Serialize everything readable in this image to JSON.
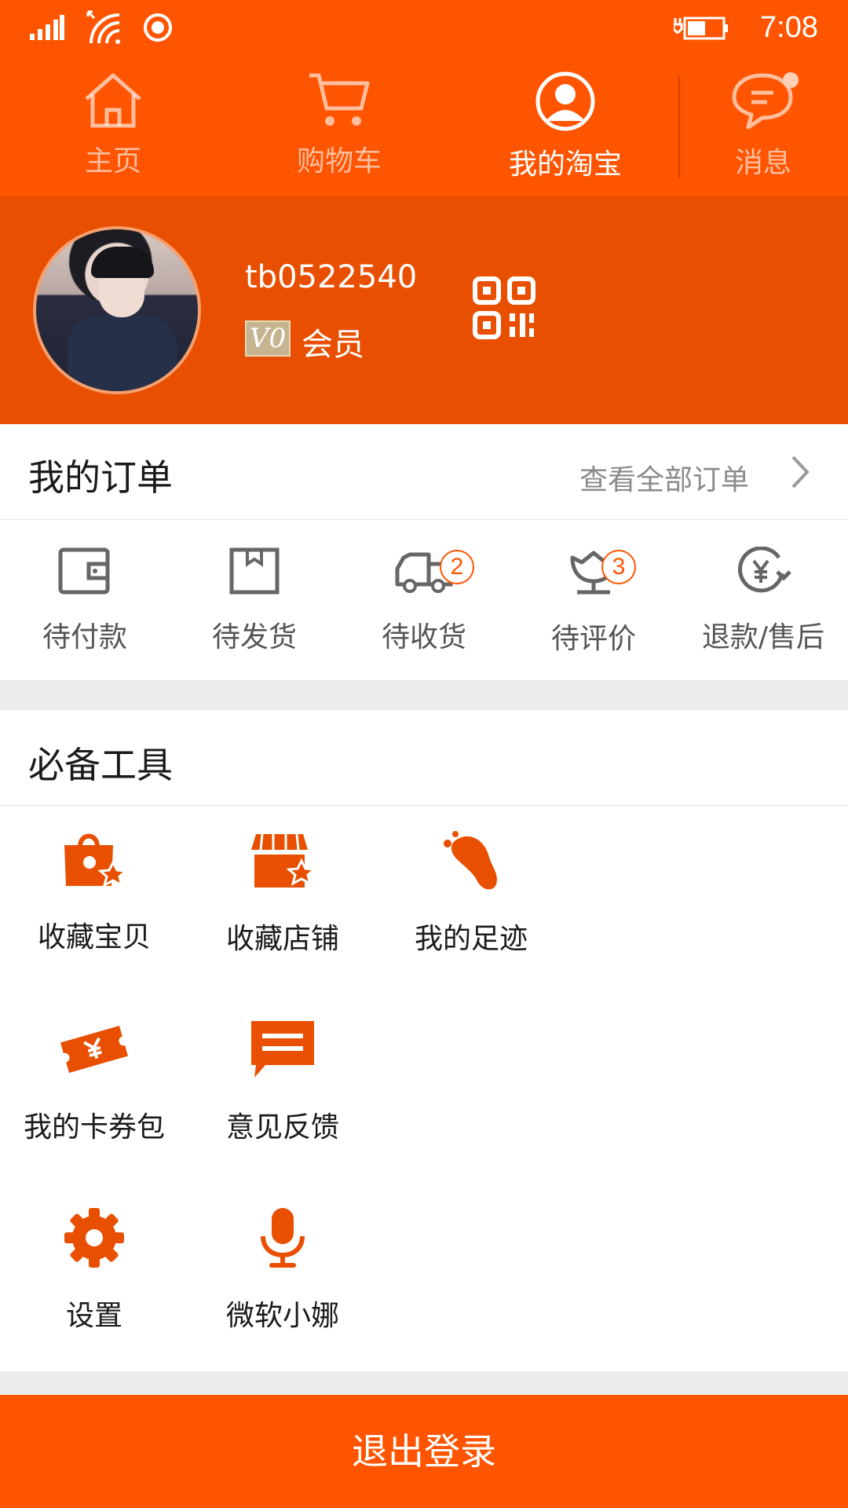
{
  "status_bar": {
    "time": "7:08"
  },
  "nav": {
    "items": [
      {
        "label": "主页",
        "icon": "home-icon"
      },
      {
        "label": "购物车",
        "icon": "cart-icon"
      },
      {
        "label": "我的淘宝",
        "icon": "user-icon",
        "active": true
      },
      {
        "label": "消息",
        "icon": "message-icon",
        "has_dot": true
      }
    ]
  },
  "profile": {
    "username": "tb0522540",
    "vip_level": "V0",
    "member_label": "会员"
  },
  "orders": {
    "title": "我的订单",
    "view_all": "查看全部订单",
    "items": [
      {
        "label": "待付款",
        "icon": "wallet-icon"
      },
      {
        "label": "待发货",
        "icon": "package-icon"
      },
      {
        "label": "待收货",
        "icon": "truck-icon",
        "badge": "2"
      },
      {
        "label": "待评价",
        "icon": "flower-icon",
        "badge": "3"
      },
      {
        "label": "退款/售后",
        "icon": "refund-icon"
      }
    ]
  },
  "tools": {
    "title": "必备工具",
    "items": [
      {
        "label": "收藏宝贝",
        "icon": "favorite-bag-icon"
      },
      {
        "label": "收藏店铺",
        "icon": "favorite-shop-icon"
      },
      {
        "label": "我的足迹",
        "icon": "footprint-icon"
      },
      {
        "label": "我的卡券包",
        "icon": "coupon-icon"
      },
      {
        "label": "意见反馈",
        "icon": "feedback-icon"
      },
      {
        "label": "设置",
        "icon": "gear-icon"
      },
      {
        "label": "微软小娜",
        "icon": "microphone-icon"
      }
    ]
  },
  "logout": {
    "label": "退出登录"
  },
  "colors": {
    "brand": "#ff5400",
    "profile_bg": "#e84f00",
    "badge": "#ff5400"
  }
}
